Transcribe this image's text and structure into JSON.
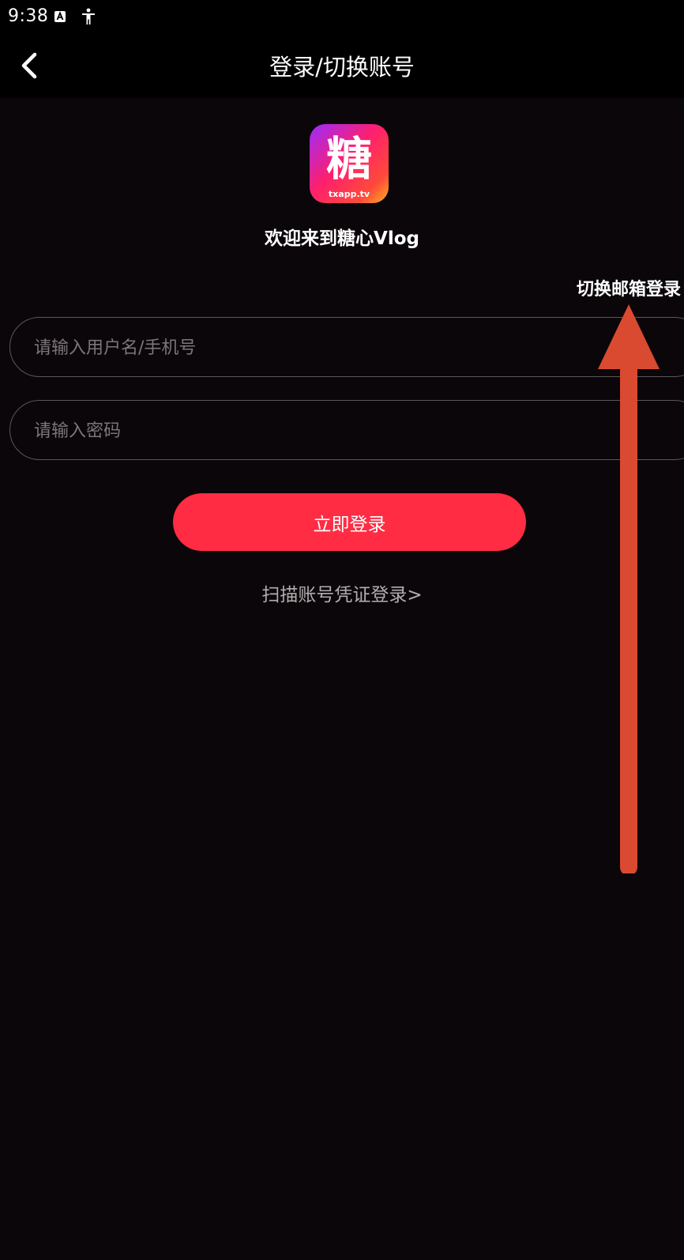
{
  "status_bar": {
    "time": "9:38",
    "icons": [
      "a-notification-icon",
      "accessibility-icon"
    ]
  },
  "nav": {
    "back_icon": "chevron-left-icon",
    "title": "登录/切换账号"
  },
  "logo": {
    "glyph": "糖",
    "caption": "txapp.tv"
  },
  "welcome": "欢迎来到糖心Vlog",
  "switch_email_label": "切换邮箱登录",
  "form": {
    "username_placeholder": "请输入用户名/手机号",
    "password_placeholder": "请输入密码",
    "login_label": "立即登录",
    "scan_label": "扫描账号凭证登录>"
  },
  "colors": {
    "background": "#0b0609",
    "bar": "#000000",
    "accent": "#ff2c43",
    "input_border": "#5c5658",
    "placeholder": "#7d7679",
    "annotation_arrow": "#d94a30"
  }
}
